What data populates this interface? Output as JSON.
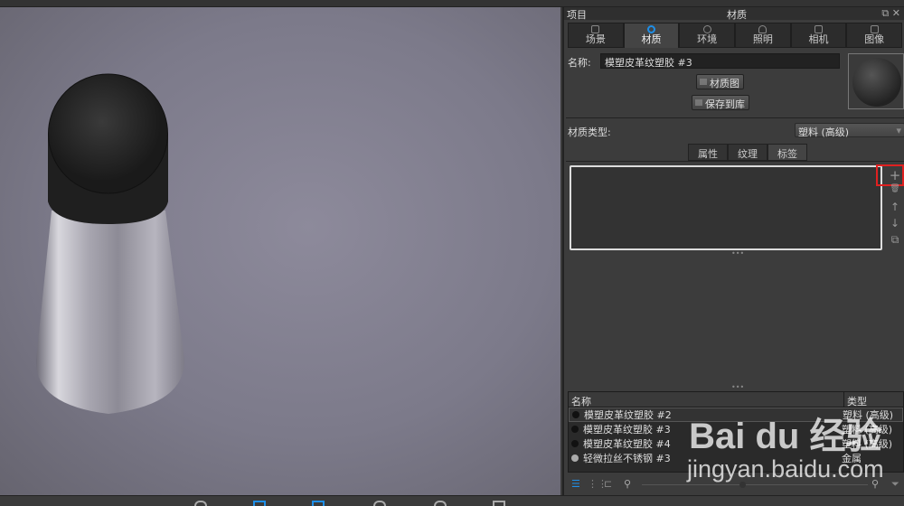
{
  "panel": {
    "left_title": "项目",
    "title": "材质",
    "window_controls": "⧉ ✕"
  },
  "tabs": [
    {
      "label": "场景",
      "icon": "scene-icon"
    },
    {
      "label": "材质",
      "icon": "material-icon",
      "active": true
    },
    {
      "label": "环境",
      "icon": "environment-icon"
    },
    {
      "label": "照明",
      "icon": "lighting-icon"
    },
    {
      "label": "相机",
      "icon": "camera-icon"
    },
    {
      "label": "图像",
      "icon": "image-icon"
    }
  ],
  "material": {
    "name_label": "名称:",
    "name_value": "模塑皮革纹塑胶 #3",
    "graph_button": "材质图",
    "save_button": "保存到库",
    "type_label": "材质类型:",
    "type_value": "塑料 (高级)"
  },
  "subtabs": [
    {
      "label": "属性"
    },
    {
      "label": "纹理"
    },
    {
      "label": "标签",
      "active": true
    }
  ],
  "side_icons": {
    "add": "+",
    "delete": "🗑",
    "up": "↑",
    "down": "↓",
    "copy": "⧉"
  },
  "library": {
    "headers": {
      "name": "名称",
      "type": "类型"
    },
    "rows": [
      {
        "name": "模塑皮革纹塑胶 #2",
        "type": "塑料 (高级)",
        "selected": true,
        "color": "#111111"
      },
      {
        "name": "模塑皮革纹塑胶 #3",
        "type": "塑料 (高级)",
        "color": "#111111"
      },
      {
        "name": "模塑皮革纹塑胶 #4",
        "type": "塑料 (高级)",
        "color": "#111111"
      },
      {
        "name": "轻微拉丝不锈钢 #3",
        "type": "金属",
        "color": "#aaaaaa"
      }
    ]
  },
  "accent_color": "#1e8fe8",
  "highlight_color": "#e02020",
  "watermark": {
    "brand": "Bai du 经验",
    "url": "jingyan.baidu.com"
  }
}
